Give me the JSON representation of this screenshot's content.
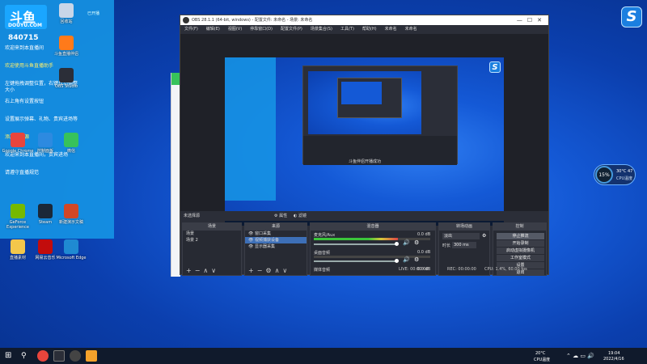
{
  "overlay": {
    "logo_big": "斗鱼",
    "logo_small": "DOUYU.COM",
    "online_label": "已开播",
    "viewer_count": "840715",
    "chat": [
      {
        "text": "欢迎来到本直播间",
        "hl": false
      },
      {
        "text": "欢迎使用斗鱼直播助手",
        "hl": true
      },
      {
        "text": "左键拖拽调整位置，右键拉动调整大小",
        "hl": false
      },
      {
        "text": "右上角有设置按钮",
        "hl": false
      },
      {
        "text": "设置展示弹幕、礼物、贵宾进场等",
        "hl": false
      },
      {
        "text": "添加弹幕源",
        "hl": true
      },
      {
        "text": "欢迎来到本直播间，贵宾进场",
        "hl": false
      },
      {
        "text": "请遵守直播规范",
        "hl": false
      }
    ]
  },
  "desktop_icons": [
    {
      "name": "recycle-bin",
      "label": "回收站",
      "color": "#c9d6e8"
    },
    {
      "name": "douyu",
      "label": "斗鱼直播伴侣",
      "color": "#ff7a1a"
    },
    {
      "name": "obs",
      "label": "OBS Studio",
      "color": "#2b2e38"
    },
    {
      "name": "chrome",
      "label": "Google Chrome",
      "color": "#e8453c"
    },
    {
      "name": "control-panel",
      "label": "控制面板",
      "color": "#2d8ae0"
    },
    {
      "name": "wechat",
      "label": "微信",
      "color": "#37c25b"
    },
    {
      "name": "nvidia",
      "label": "GeForce Experience",
      "color": "#76b900"
    },
    {
      "name": "steam",
      "label": "Steam",
      "color": "#1b2838"
    },
    {
      "name": "ppt",
      "label": "新建演示文稿",
      "color": "#d24726"
    },
    {
      "name": "folder",
      "label": "直播素材",
      "color": "#f3c74b"
    },
    {
      "name": "music",
      "label": "网易云音乐",
      "color": "#c20c0c"
    },
    {
      "name": "edge",
      "label": "Microsoft Edge",
      "color": "#1f8ad2"
    }
  ],
  "obs": {
    "title": "OBS 28.1.1 (64-bit, windows) - 配置文件: 未命名 - 场景: 未命名",
    "menu": [
      "文件(F)",
      "编辑(E)",
      "视图(V)",
      "停靠窗口(D)",
      "配置文件(P)",
      "场景集合(S)",
      "工具(T)",
      "帮助(H)",
      "未命名",
      "未命名"
    ],
    "preview_caption": "斗鱼伴侣开播成功",
    "scene_bar_label": "未选择源",
    "scene_bar_props": "属性",
    "scene_bar_filters": "滤镜",
    "docks": {
      "scenes": {
        "title": "场景",
        "items": [
          "场景",
          "场景 2"
        ]
      },
      "sources": {
        "title": "来源",
        "items": [
          "窗口采集",
          "视频捕获设备",
          "显示器采集"
        ],
        "selected": 1
      },
      "mixer": {
        "title": "混音器",
        "channels": [
          {
            "name": "麦克风/Aux",
            "db": "0.0 dB"
          },
          {
            "name": "桌面音频",
            "db": "0.0 dB"
          },
          {
            "name": "媒体音频",
            "db": "0.0 dB"
          }
        ]
      },
      "transitions": {
        "title": "转场动画",
        "type": "淡出",
        "duration_label": "时长",
        "duration": "300 ms"
      },
      "controls": {
        "title": "控制",
        "buttons": [
          "停止推流",
          "开始录制",
          "启动虚拟摄像机",
          "工作室模式",
          "设置",
          "退出"
        ]
      }
    },
    "status": {
      "live": "LIVE: 00:00:00",
      "rec": "REC: 00:00:00",
      "cpu": "CPU: 1.4%, 60.00 fps"
    }
  },
  "cpu_widget": {
    "percent": "15%",
    "temp": "30°C 47",
    "label": "CPU温度"
  },
  "taskbar": {
    "search_icon": "search-icon",
    "weather": "20°C",
    "weather_label": "CPU温度",
    "time": "19:04",
    "date": "2022/4/16"
  }
}
